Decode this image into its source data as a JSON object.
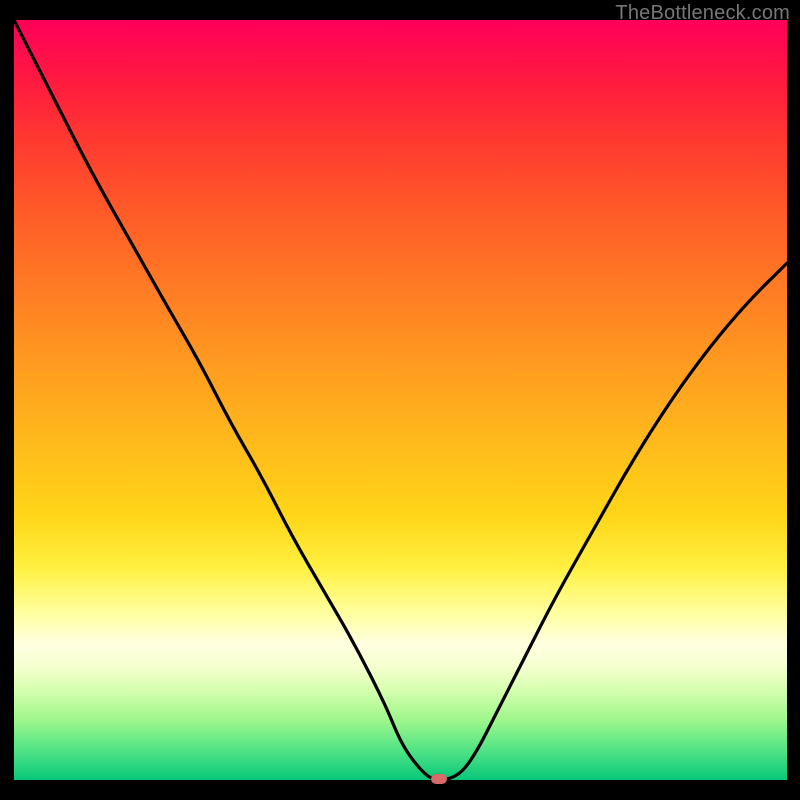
{
  "attribution": "TheBottleneck.com",
  "colors": {
    "background": "#000000",
    "curve": "#000000",
    "marker": "#d86a6a",
    "gradient_stops": [
      "#ff005a",
      "#ff1a40",
      "#ff3a30",
      "#ff5a28",
      "#ff7a24",
      "#ff9a20",
      "#ffb81c",
      "#ffd518",
      "#fff040",
      "#ffffa0",
      "#ffffe0",
      "#f5ffd0",
      "#d8ffb0",
      "#a0f78c",
      "#52e485",
      "#08c77a"
    ]
  },
  "chart_data": {
    "type": "line",
    "title": "",
    "xlabel": "",
    "ylabel": "",
    "xlim": [
      0,
      100
    ],
    "ylim": [
      0,
      100
    ],
    "x": [
      0,
      5,
      10,
      15,
      20,
      24,
      28,
      32,
      36,
      40,
      44,
      48,
      50,
      52,
      54,
      56,
      58,
      60,
      62,
      66,
      70,
      75,
      80,
      85,
      90,
      95,
      100
    ],
    "values": [
      100,
      90,
      80,
      71,
      62,
      55,
      47,
      40,
      32,
      25,
      18,
      10,
      5,
      2,
      0,
      0,
      1,
      4,
      8,
      16,
      24,
      33,
      42,
      50,
      57,
      63,
      68
    ],
    "marker": {
      "x": 55,
      "y": 0
    },
    "description": "V-shaped bottleneck curve; minimum approximately at x≈55 where mismatch approaches 0%. Left branch steeper than right. Background color encodes bottleneck severity from red (high) through yellow to green (low)."
  }
}
